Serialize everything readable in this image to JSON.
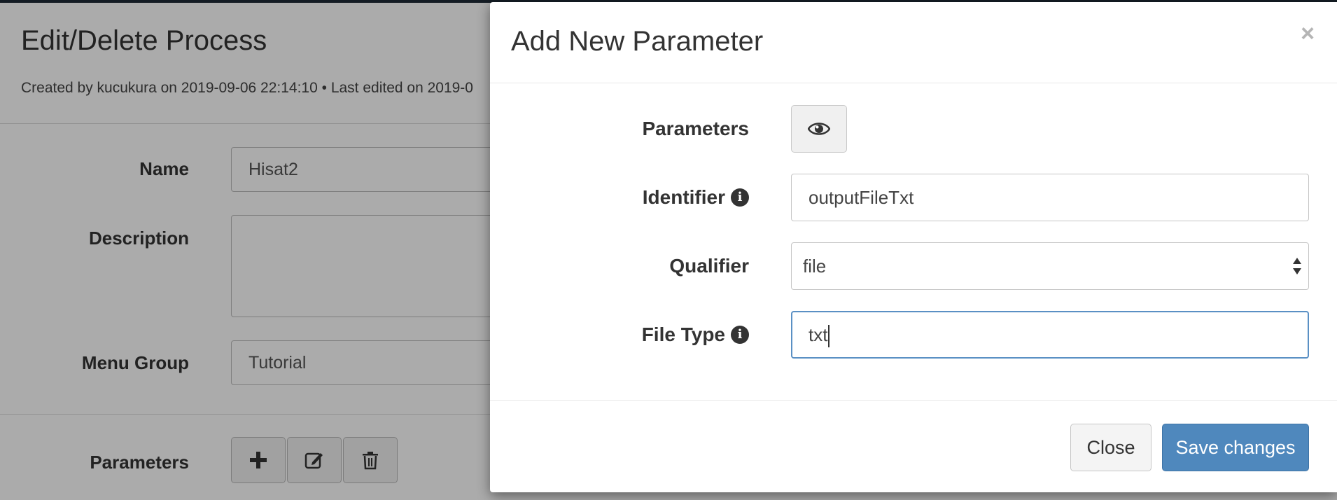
{
  "background_page": {
    "title": "Edit/Delete Process",
    "meta": "Created by kucukura on 2019-09-06 22:14:10 • Last edited on 2019-0",
    "fields": {
      "name_label": "Name",
      "name_value": "Hisat2",
      "description_label": "Description",
      "description_value": "",
      "menu_group_label": "Menu Group",
      "menu_group_value": "Tutorial",
      "parameters_label": "Parameters"
    },
    "parameter_buttons": [
      "plus-icon",
      "edit-icon",
      "trash-icon"
    ]
  },
  "modal": {
    "title": "Add New Parameter",
    "close_symbol": "×",
    "parameters_label": "Parameters",
    "identifier_label": "Identifier",
    "identifier_value": "outputFileTxt",
    "qualifier_label": "Qualifier",
    "qualifier_value": "file",
    "file_type_label": "File Type",
    "file_type_value": "txt",
    "info_symbol": "i",
    "close_button": "Close",
    "save_button": "Save changes"
  },
  "colors": {
    "primary": "#4f88bd",
    "focus_border": "#5a90c4",
    "overlay": "rgba(0,0,0,0.33)"
  }
}
